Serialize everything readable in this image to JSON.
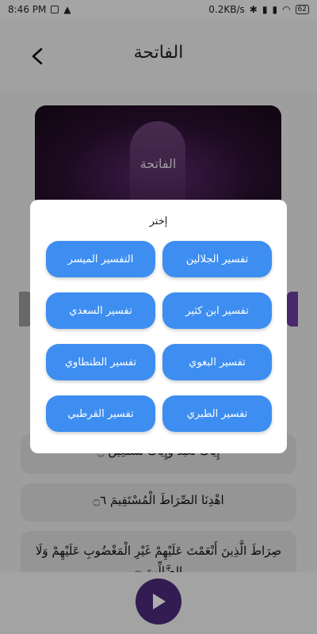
{
  "status_bar": {
    "time": "8:46 PM",
    "net_speed": "0.2KB/s",
    "battery": "62"
  },
  "header": {
    "title": "الفاتحة"
  },
  "banner": {
    "title": "الفاتحة"
  },
  "verses": [
    {
      "text": "إِيَّاكَ نَعْبُدُ وَإِيَّاكَ نَسْتَعِينُ ۝"
    },
    {
      "text": "اهْدِنَا الصِّرَاطَ الْمُسْتَقِيمَ ۝٦"
    },
    {
      "text": "صِرَاطَ الَّذِينَ أَنْعَمْتَ عَلَيْهِمْ غَيْرِ الْمَغْضُوبِ عَلَيْهِمْ وَلَا الضَّالِّينَ ۝"
    }
  ],
  "dialog": {
    "title": "إختر",
    "options": [
      "تفسير الجلالين",
      "التفسير الميسر",
      "تفسير ابن كثير",
      "تفسير السعدي",
      "تفسير البغوي",
      "تفسير الطنطاوي",
      "تفسير الطبري",
      "تفسير القرطبي"
    ]
  },
  "colors": {
    "accent": "#3d8ef0",
    "play": "#4b2a79",
    "purple": "#6b3fa0"
  }
}
